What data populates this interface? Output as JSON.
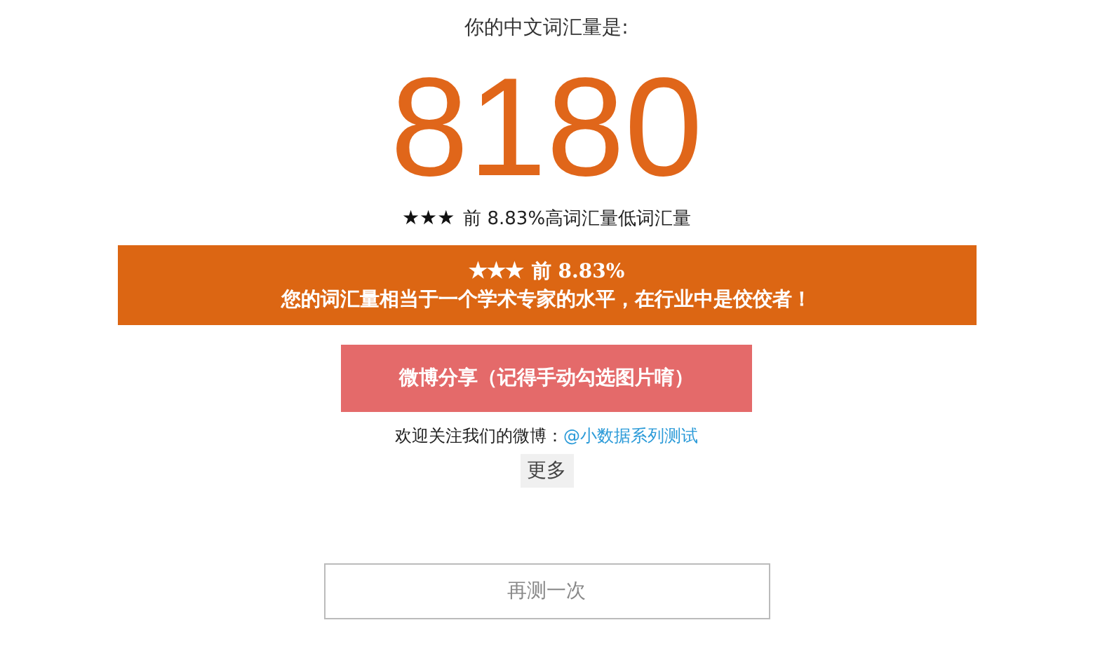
{
  "heading": "你的中文词汇量是:",
  "score": "8180",
  "rating": {
    "stars": 3,
    "text": "前 8.83%高词汇量低词汇量"
  },
  "banner": {
    "stars": 3,
    "rank": "前 8.83%",
    "message": "您的词汇量相当于一个学术专家的水平，在行业中是佼佼者！"
  },
  "share_button": "微博分享（记得手动勾选图片唷）",
  "follow": {
    "text": "欢迎关注我们的微博：",
    "link": "@小数据系列测试"
  },
  "more_button": "更多",
  "retry_button": "再测一次"
}
